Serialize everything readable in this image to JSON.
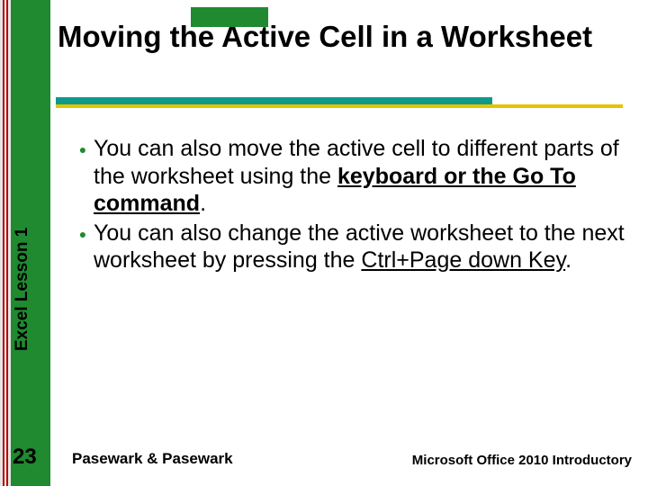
{
  "slide": {
    "title": "Moving the Active Cell in a Worksheet",
    "sidebar_label": "Excel Lesson 1",
    "page_number": "23",
    "footer_left": "Pasewark & Pasewark",
    "footer_right": "Microsoft Office 2010 Introductory",
    "bullets": [
      {
        "pre": "You can also move the active cell to different parts of the worksheet using the ",
        "emph": "keyboard or the Go To command",
        "emph_style": "bold-underline",
        "post": "."
      },
      {
        "pre": "You can also change the active worksheet to the next worksheet by pressing the ",
        "emph": "Ctrl+Page down Key",
        "emph_style": "underline",
        "post": "."
      }
    ],
    "colors": {
      "green": "#1f8a2f",
      "teal": "#0d9a8b",
      "yellow": "#e3c400",
      "red": "#b40000"
    }
  }
}
